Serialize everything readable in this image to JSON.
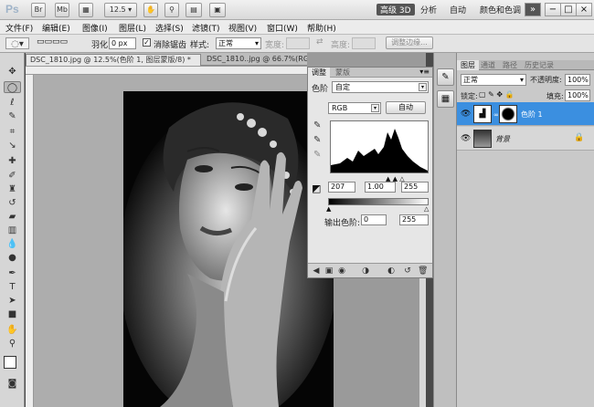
{
  "app": {
    "logo": "Ps",
    "zoom_value": "12.5",
    "workspaces": [
      "高级 3D",
      "分析",
      "自动",
      "颜色和色调"
    ],
    "window_controls": [
      "−",
      "□",
      "×"
    ]
  },
  "menubar": {
    "items": [
      "文件(F)",
      "编辑(E)",
      "图像(I)",
      "图层(L)",
      "选择(S)",
      "滤镜(T)",
      "视图(V)",
      "窗口(W)",
      "帮助(H)"
    ]
  },
  "options": {
    "feather_label": "羽化:",
    "feather_value": "0 px",
    "antialias_label": "消除锯齿",
    "style_label": "样式:",
    "style_value": "正常",
    "width_label": "宽度:",
    "height_label": "高度:",
    "refine_edge": "调整边缘..."
  },
  "document_tabs": [
    "DSC_1810.jpg @ 12.5%(色阶 1, 图层蒙版/8) *",
    "DSC_1810..jpg @ 66.7%(RGB/8)"
  ],
  "adjustments": {
    "tabs": [
      "调整",
      "蒙版"
    ],
    "preset_label": "色阶",
    "preset_value": "自定",
    "channel_value": "RGB",
    "auto_button": "自动",
    "input_black": "207",
    "input_gamma": "1.00",
    "input_white": "255",
    "output_label": "输出色阶:",
    "output_black": "0",
    "output_white": "255"
  },
  "layers": {
    "tabs": [
      "图层",
      "通道",
      "路径",
      "历史记录"
    ],
    "blend_mode": "正常",
    "opacity_label": "不透明度:",
    "opacity_value": "100%",
    "lock_label": "锁定:",
    "fill_label": "填充:",
    "fill_value": "100%",
    "items": [
      {
        "name": "色阶 1",
        "selected": true
      },
      {
        "name": "背景",
        "selected": false
      }
    ]
  },
  "colors": {
    "selection_blue": "#3b8fe0",
    "canvas_gray": "#adadad",
    "panel_gray": "#e6e6e6"
  }
}
